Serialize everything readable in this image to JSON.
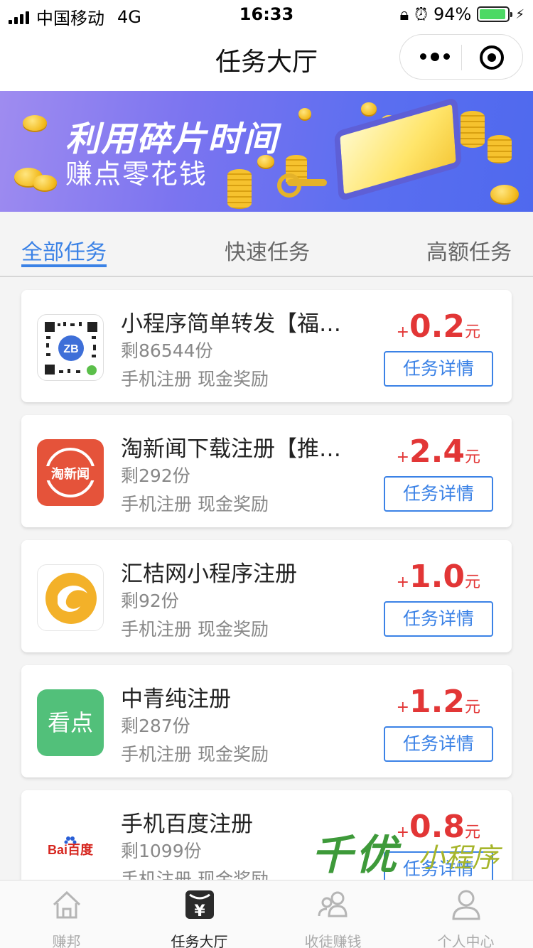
{
  "status_bar": {
    "carrier": "中国移动",
    "network": "4G",
    "time": "16:33",
    "battery_percent": "94%",
    "battery_level": 0.94
  },
  "nav": {
    "title": "任务大厅"
  },
  "banner": {
    "line1": "利用碎片时间",
    "line2": "赚点零花钱"
  },
  "tabs": [
    {
      "label": "全部任务",
      "active": true
    },
    {
      "label": "快速任务",
      "active": false
    },
    {
      "label": "高额任务",
      "active": false
    }
  ],
  "tasks": [
    {
      "title": "小程序简单转发【福…",
      "remaining": "剩86544份",
      "tags": "手机注册 现金奖励",
      "plus": "+",
      "amount": "0.2",
      "unit": "元",
      "button": "任务详情",
      "icon": "qr-code-icon",
      "icon_text": "ZB"
    },
    {
      "title": "淘新闻下载注册【推…",
      "remaining": "剩292份",
      "tags": "手机注册 现金奖励",
      "plus": "+",
      "amount": "2.4",
      "unit": "元",
      "button": "任务详情",
      "icon": "taoxinwen-logo-icon",
      "icon_text": "淘新闻"
    },
    {
      "title": "汇桔网小程序注册",
      "remaining": "剩92份",
      "tags": "手机注册 现金奖励",
      "plus": "+",
      "amount": "1.0",
      "unit": "元",
      "button": "任务详情",
      "icon": "huijie-logo-icon",
      "icon_text": ""
    },
    {
      "title": "中青纯注册",
      "remaining": "剩287份",
      "tags": "手机注册 现金奖励",
      "plus": "+",
      "amount": "1.2",
      "unit": "元",
      "button": "任务详情",
      "icon": "kandian-logo-icon",
      "icon_text": "看点"
    },
    {
      "title": "手机百度注册",
      "remaining": "剩1099份",
      "tags": "手机注册 现金奖励",
      "plus": "+",
      "amount": "0.8",
      "unit": "元",
      "button": "任务详情",
      "icon": "baidu-logo-icon",
      "icon_text": "Bai百度"
    }
  ],
  "watermark": {
    "big": "千优",
    "small": "小程序"
  },
  "tab_bar": [
    {
      "label": "赚邦",
      "icon": "home-icon",
      "active": false
    },
    {
      "label": "任务大厅",
      "icon": "wallet-yen-icon",
      "active": true
    },
    {
      "label": "收徒赚钱",
      "icon": "users-icon",
      "active": false
    },
    {
      "label": "个人中心",
      "icon": "person-icon",
      "active": false
    }
  ],
  "colors": {
    "accent": "#3b82e6",
    "reward": "#e23636",
    "battery": "#4cd964"
  }
}
